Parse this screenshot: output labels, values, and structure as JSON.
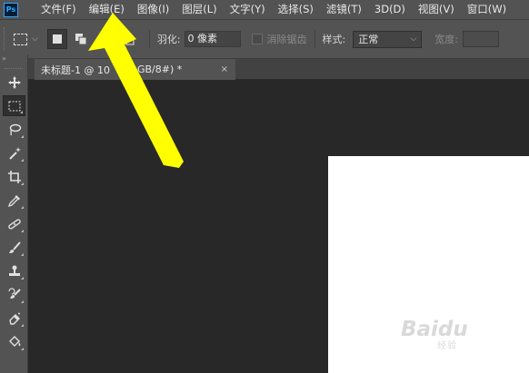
{
  "app": {
    "logo_text": "Ps"
  },
  "menu": {
    "items": [
      "文件(F)",
      "编辑(E)",
      "图像(I)",
      "图层(L)",
      "文字(Y)",
      "选择(S)",
      "滤镜(T)",
      "3D(D)",
      "视图(V)",
      "窗口(W)"
    ]
  },
  "options": {
    "feather_label": "羽化:",
    "feather_value": "0 像素",
    "antialias_label": "消除锯齿",
    "style_label": "样式:",
    "style_value": "正常",
    "width_label": "宽度:"
  },
  "document_tab": {
    "title": "未标题-1 @ 10",
    "title_suffix": "GB/8#) *",
    "close_glyph": "×"
  },
  "toolbar": {
    "collapse_glyph": "»",
    "tools": [
      "move-icon",
      "rect-marquee-icon",
      "lasso-icon",
      "magic-wand-icon",
      "crop-icon",
      "eyedropper-icon",
      "healing-brush-icon",
      "brush-icon",
      "clone-stamp-icon",
      "history-brush-icon",
      "eraser-icon",
      "paint-bucket-icon"
    ]
  },
  "watermark": {
    "main": "Baidu",
    "sub": "经验"
  },
  "colors": {
    "ui_panel": "#535353",
    "canvas_bg": "#282828",
    "arrow": "#ffff00"
  }
}
